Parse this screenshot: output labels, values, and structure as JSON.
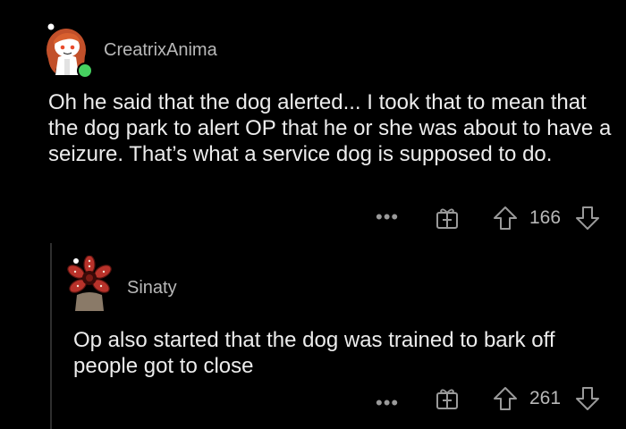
{
  "comments": [
    {
      "username": "CreatrixAnima",
      "online": true,
      "text": "Oh he said that the dog alerted... I took that to mean that the dog park to alert OP that he or she was about to have a seizure. That’s what a service dog is supposed to do.",
      "more_label": "•••",
      "award_icon": "gift-icon",
      "upvote_icon": "arrow-up-icon",
      "score": "166",
      "downvote_icon": "arrow-down-icon"
    },
    {
      "username": "Sinaty",
      "text": "Op also started that the dog was trained to bark off people got to close",
      "more_label": "•••",
      "award_icon": "gift-icon",
      "upvote_icon": "arrow-up-icon",
      "score": "261",
      "downvote_icon": "arrow-down-icon"
    }
  ],
  "colors": {
    "background": "#000000",
    "text": "#ececec",
    "muted": "#9a9a9a",
    "online": "#46d160",
    "thread_line": "#2f2f2f"
  }
}
